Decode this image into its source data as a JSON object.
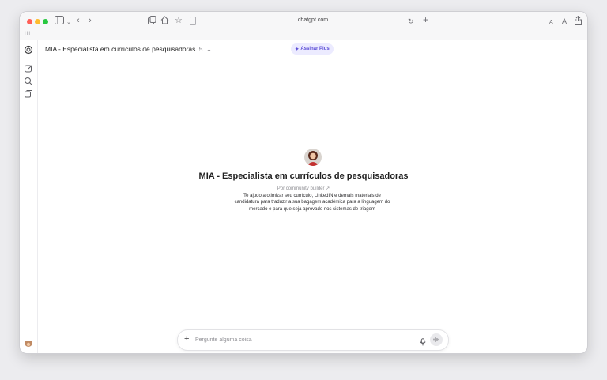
{
  "browser": {
    "url": "chatgpt.com",
    "tab_indicator": "III",
    "text_size_small": "A",
    "text_size_large": "A",
    "traffic_colors": [
      "#ff5f57",
      "#febc2e",
      "#28c840"
    ]
  },
  "header": {
    "model_title": "MIA - Especialista em currículos de pesquisadoras",
    "model_version": "5",
    "upgrade_label": "Assinar Plus",
    "upgrade_icon": "sparkle-icon"
  },
  "sidebar": {
    "icons": [
      "openai-logo-icon",
      "new-chat-icon",
      "search-icon",
      "library-icon"
    ]
  },
  "gpt": {
    "name": "MIA - Especialista em currículos de pesquisadoras",
    "builder": "Por community builder ↗",
    "description": "Te ajudo a otimizar seu currículo, LinkedIN e demais materiais de candidatura para traduzir a sua bagagem acadêmica para a linguagem do mercado e para que seja aprovado nos sistemas de triagem"
  },
  "composer": {
    "placeholder": "Pergunte alguma coisa",
    "value": ""
  },
  "colors": {
    "accent": "#5b4dd6",
    "accent_bg": "#ecebff"
  }
}
